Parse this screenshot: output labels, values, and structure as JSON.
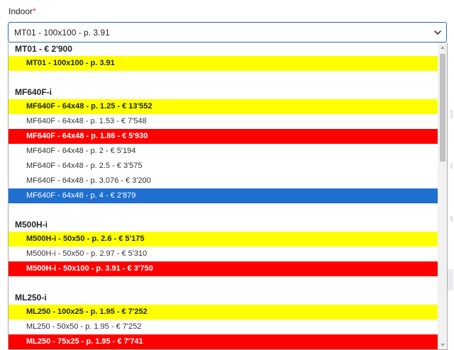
{
  "field": {
    "label": "Indoor",
    "required_mark": "*",
    "selected_value": "MT01 - 100x100 - p. 3.91"
  },
  "groups": [
    {
      "label": "MT01 - € 2'900",
      "options": [
        {
          "text": "MT01 - 100x100 - p. 3.91",
          "style": "yellow"
        }
      ]
    },
    {
      "label": "MF640F-i",
      "options": [
        {
          "text": "MF640F - 64x48 - p. 1.25 - € 13'552",
          "style": "yellow"
        },
        {
          "text": "MF640F - 64x48 - p. 1.53 - € 7'548",
          "style": "plain"
        },
        {
          "text": "MF640F - 64x48 - p. 1.86 - € 5'930",
          "style": "red"
        },
        {
          "text": "MF640F - 64x48 - p. 2 - € 5'194",
          "style": "plain"
        },
        {
          "text": "MF640F - 64x48 - p. 2.5 - € 3'575",
          "style": "plain"
        },
        {
          "text": "MF640F - 64x48 - p. 3.076 - € 3'200",
          "style": "plain"
        },
        {
          "text": "MF640F - 64x48 - p. 4 - € 2'879",
          "style": "active"
        }
      ]
    },
    {
      "label": "M500H-i",
      "options": [
        {
          "text": "M500H-i - 50x50 - p. 2.6 - € 5'175",
          "style": "yellow"
        },
        {
          "text": "M500H-i - 50x50 - p. 2.97 - € 5'310",
          "style": "plain"
        },
        {
          "text": "M500H-i - 50x100 - p. 3.91 - € 3'750",
          "style": "red"
        }
      ]
    },
    {
      "label": "ML250-i",
      "options": [
        {
          "text": "ML250 - 100x25 - p. 1.95 - € 7'252",
          "style": "yellow"
        },
        {
          "text": "ML250 - 50x50 - p. 1.95 - € 7'252",
          "style": "plain"
        },
        {
          "text": "ML250 - 75x25 - p. 1.95 - € 7'741",
          "style": "red"
        }
      ]
    }
  ],
  "colors": {
    "highlight_yellow": "#ffff00",
    "highlight_red": "#ff0000",
    "active_blue": "#1f6fd0",
    "focus_border": "#2f66a6"
  },
  "icons": {
    "select_arrow": "chevron-down-icon",
    "scroll_up": "scroll-up-arrow-icon",
    "scroll_down": "scroll-down-arrow-icon"
  }
}
